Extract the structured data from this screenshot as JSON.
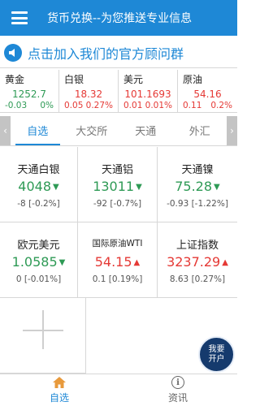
{
  "header": {
    "title": "货币兑换--为您推送专业信息",
    "menu_icon": "hamburger-menu-icon",
    "background": "#1e88d6"
  },
  "promo": {
    "text": "点击加入我们的官方顾问群",
    "icon": "speaker-icon"
  },
  "ticker": [
    {
      "name": "黄金",
      "price": "1252.7",
      "change": "-0.03",
      "percent": "0%",
      "trend": "down"
    },
    {
      "name": "白银",
      "price": "18.32",
      "change": "0.05",
      "percent": "0.27%",
      "trend": "up"
    },
    {
      "name": "美元",
      "price": "101.1693",
      "change": "0.01",
      "percent": "0.01%",
      "trend": "up"
    },
    {
      "name": "原油",
      "price": "54.16",
      "change": "0.11",
      "percent": "0.2%",
      "trend": "up"
    }
  ],
  "tabs": {
    "prev_arrow": "‹",
    "next_arrow": "›",
    "items": [
      {
        "label": "自选",
        "active": true
      },
      {
        "label": "大交所",
        "active": false
      },
      {
        "label": "天通",
        "active": false
      },
      {
        "label": "外汇",
        "active": false
      }
    ]
  },
  "quotes": [
    {
      "name": "天通白银",
      "price": "4048",
      "arrow": "▼",
      "change": "-8 [-0.2%]",
      "trend": "down"
    },
    {
      "name": "天通铝",
      "price": "13011",
      "arrow": "▼",
      "change": "-92 [-0.7%]",
      "trend": "down"
    },
    {
      "name": "天通镍",
      "price": "75.28",
      "arrow": "▼",
      "change": "-0.93 [-1.22%]",
      "trend": "down"
    },
    {
      "name": "欧元美元",
      "price": "1.0585",
      "arrow": "▼",
      "change": "0 [-0.01%]",
      "trend": "down"
    },
    {
      "name": "国际原油WTI",
      "price": "54.15",
      "arrow": "▲",
      "change": "0.1 [0.19%]",
      "trend": "up"
    },
    {
      "name": "上证指数",
      "price": "3237.29",
      "arrow": "▲",
      "change": "8.63 [0.27%]",
      "trend": "up"
    }
  ],
  "add_button": {
    "icon": "plus-icon"
  },
  "badge": {
    "line1": "我要",
    "line2": "开户"
  },
  "bottom_nav": [
    {
      "label": "自选",
      "icon": "home-icon",
      "active": true
    },
    {
      "label": "资讯",
      "icon": "info-icon",
      "active": false
    }
  ],
  "colors": {
    "accent": "#1e88d6",
    "up": "#e53935",
    "down": "#2e9a55"
  }
}
